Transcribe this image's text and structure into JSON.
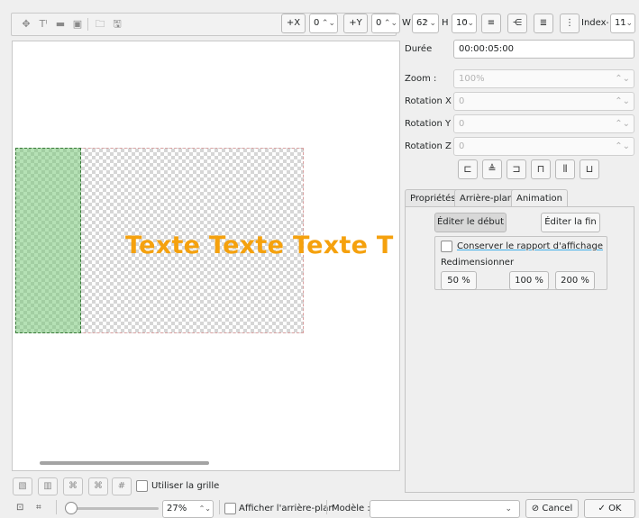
{
  "toolbar": {
    "icons": [
      "move-icon",
      "text-icon",
      "rect-icon",
      "image-icon",
      "open-icon",
      "save-icon"
    ],
    "plus_x_label": "+X",
    "x_value": "0",
    "plus_y_label": "+Y",
    "y_value": "0",
    "w_label": "W",
    "w_value": "62",
    "h_label": "H",
    "h_value": "10",
    "index_label": "Index-z",
    "index_value": "11"
  },
  "canvas": {
    "text": "Texte Texte Texte T",
    "text_color": "#f5a10d"
  },
  "panel": {
    "duration_label": "Durée",
    "duration_value": "00:00:05:00",
    "zoom_label": "Zoom :",
    "zoom_value": "100%",
    "rotx_label": "Rotation X :",
    "rotx_value": "0",
    "roty_label": "Rotation Y :",
    "roty_value": "0",
    "rotz_label": "Rotation Z :",
    "rotz_value": "0",
    "align_icons": [
      "align-left-icon",
      "align-hcenter-icon",
      "align-right-icon",
      "align-top-icon",
      "align-vcenter-icon",
      "align-bottom-icon"
    ],
    "tabs": [
      "Propriétés",
      "Arrière-plan",
      "Animation"
    ],
    "active_tab": "Animation",
    "edit_start_label": "Éditer le début",
    "edit_end_label": "Éditer la fin",
    "keep_ratio_label": "Conserver le rapport d'affichage",
    "resize_label": "Redimensionner",
    "resize_50": "50 %",
    "resize_100": "100 %",
    "resize_200": "200 %"
  },
  "bottom": {
    "use_grid_label": "Utiliser la grille",
    "zoom_value": "27%",
    "zoom_fraction": 0.27,
    "show_background_label": "Afficher l'arrière-plan",
    "model_label": "Modèle :",
    "model_value": "",
    "cancel_label": "Cancel",
    "ok_label": "OK"
  }
}
